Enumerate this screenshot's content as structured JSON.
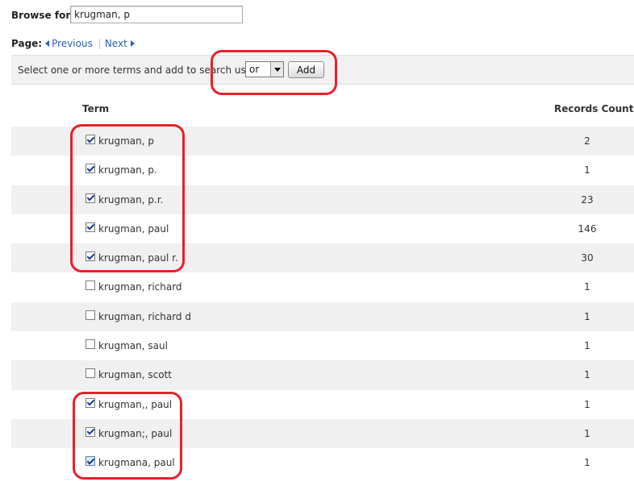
{
  "browse": {
    "label": "Browse for:",
    "value": "krugman, p"
  },
  "paging": {
    "label": "Page:",
    "previous": "Previous",
    "next": "Next"
  },
  "toolbar": {
    "instruction": "Select one or more terms and add to search using:",
    "operator": "or",
    "add_label": "Add"
  },
  "table": {
    "headers": {
      "term": "Term",
      "count": "Records Count"
    },
    "rows": [
      {
        "term": "krugman, p",
        "count": "2",
        "checked": true
      },
      {
        "term": "krugman, p.",
        "count": "1",
        "checked": true
      },
      {
        "term": "krugman, p.r.",
        "count": "23",
        "checked": true
      },
      {
        "term": "krugman, paul",
        "count": "146",
        "checked": true
      },
      {
        "term": "krugman, paul r.",
        "count": "30",
        "checked": true
      },
      {
        "term": "krugman, richard",
        "count": "1",
        "checked": false
      },
      {
        "term": "krugman, richard d",
        "count": "1",
        "checked": false
      },
      {
        "term": "krugman, saul",
        "count": "1",
        "checked": false
      },
      {
        "term": "krugman, scott",
        "count": "1",
        "checked": false
      },
      {
        "term": "krugman,, paul",
        "count": "1",
        "checked": true
      },
      {
        "term": "krugman;, paul",
        "count": "1",
        "checked": true
      },
      {
        "term": "krugmana, paul",
        "count": "1",
        "checked": true
      }
    ]
  },
  "colors": {
    "highlight": "#e8202a",
    "link": "#2a5db0",
    "row_alt": "#f0f0f0"
  }
}
